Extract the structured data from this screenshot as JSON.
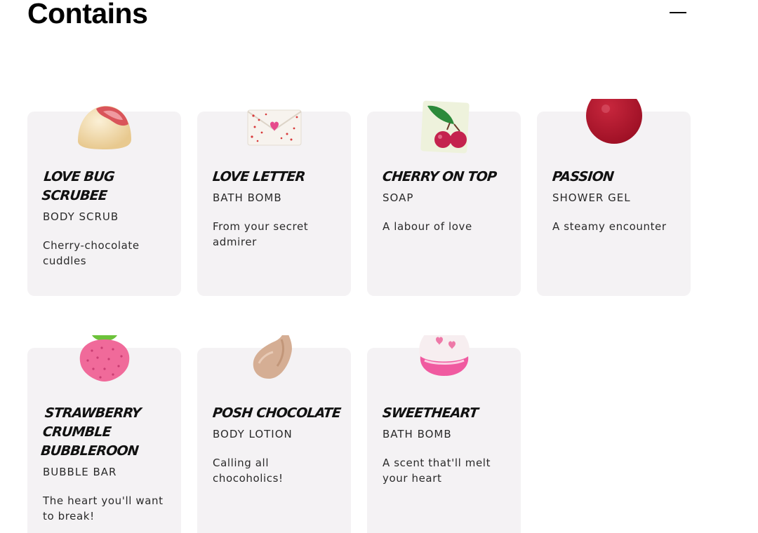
{
  "section": {
    "title": "Contains",
    "toggle_icon": "minus-icon"
  },
  "products": [
    {
      "name": "Love Bug Scrubee",
      "category": "Body Scrub",
      "tagline": "Cherry-chocolate cuddles",
      "icon": "scrub-ball-icon"
    },
    {
      "name": "Love Letter",
      "category": "Bath Bomb",
      "tagline": "From your secret admirer",
      "icon": "envelope-bath-bomb-icon"
    },
    {
      "name": "Cherry On Top",
      "category": "Soap",
      "tagline": "A labour of love",
      "icon": "cherry-soap-icon"
    },
    {
      "name": "Passion",
      "category": "Shower Gel",
      "tagline": "A steamy encounter",
      "icon": "gel-swatch-icon"
    },
    {
      "name": "Strawberry Crumble Bubbleroon",
      "category": "Bubble Bar",
      "tagline": "The heart you'll want to break!",
      "icon": "strawberry-icon"
    },
    {
      "name": "Posh Chocolate",
      "category": "Body Lotion",
      "tagline": "Calling all chocoholics!",
      "icon": "lotion-swatch-icon"
    },
    {
      "name": "Sweetheart",
      "category": "Bath Bomb",
      "tagline": "A scent that'll melt your heart",
      "icon": "heart-bath-bomb-icon"
    }
  ],
  "colors": {
    "card_background": "#f4f2f4",
    "text": "#1c1c1c"
  }
}
